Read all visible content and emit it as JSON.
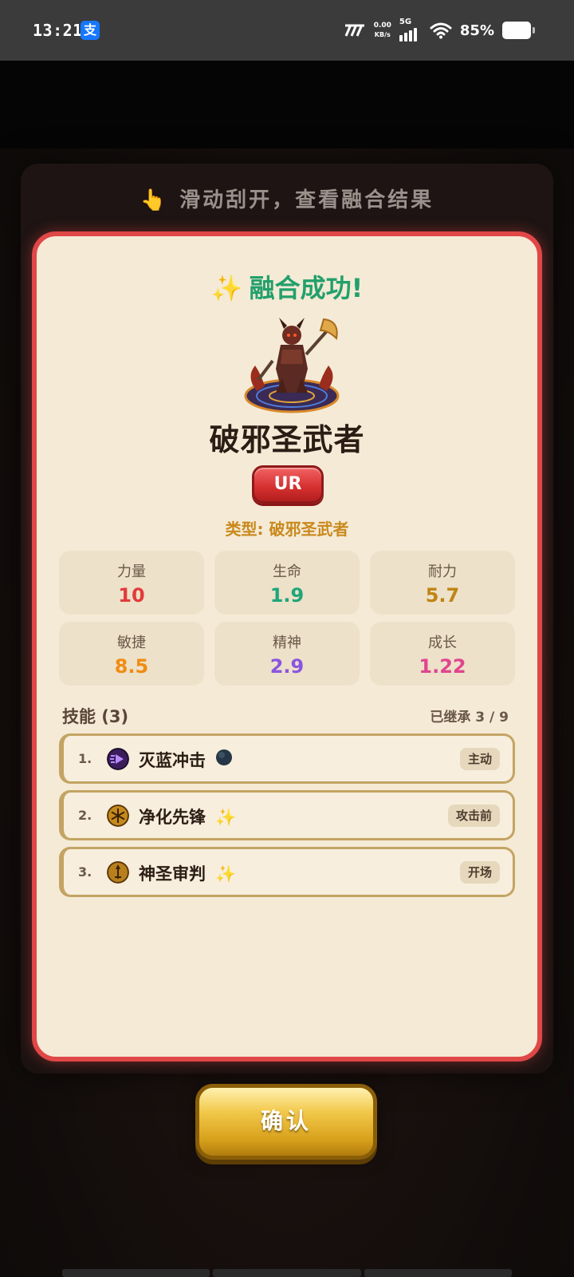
{
  "status_bar": {
    "time": "13:21",
    "alipay_glyph": "支",
    "net_speed_value": "0.00",
    "net_speed_unit": "KB/s",
    "network": "5G",
    "battery": "85%"
  },
  "hint": {
    "icon": "pointing-hand-icon",
    "text": "滑动刮开，查看融合结果"
  },
  "card": {
    "success_text": "融合成功!",
    "hero_name": "破邪圣武者",
    "rarity": "UR",
    "type_line": "类型: 破邪圣武者",
    "stats": [
      {
        "label": "力量",
        "value": "10",
        "color": "#e23b3b"
      },
      {
        "label": "生命",
        "value": "1.9",
        "color": "#1fa67a"
      },
      {
        "label": "耐力",
        "value": "5.7",
        "color": "#c08413"
      },
      {
        "label": "敏捷",
        "value": "8.5",
        "color": "#f08c12"
      },
      {
        "label": "精神",
        "value": "2.9",
        "color": "#8a55e0"
      },
      {
        "label": "成长",
        "value": "1.22",
        "color": "#e0458f"
      }
    ],
    "skills_title": "技能 (3)",
    "skills_inherited": "已继承 3 / 9",
    "skills": [
      {
        "num": "1.",
        "name": "灭蓝冲击",
        "icon": "purple-play-icon",
        "suffix_icon": "dark-moon-icon",
        "tag": "主动"
      },
      {
        "num": "2.",
        "name": "净化先锋",
        "icon": "golden-star-icon",
        "suffix_icon": "sparkles-icon",
        "tag": "攻击前"
      },
      {
        "num": "3.",
        "name": "神圣审判",
        "icon": "golden-sword-icon",
        "suffix_icon": "sparkles-icon",
        "tag": "开场"
      }
    ]
  },
  "confirm_label": "确认"
}
